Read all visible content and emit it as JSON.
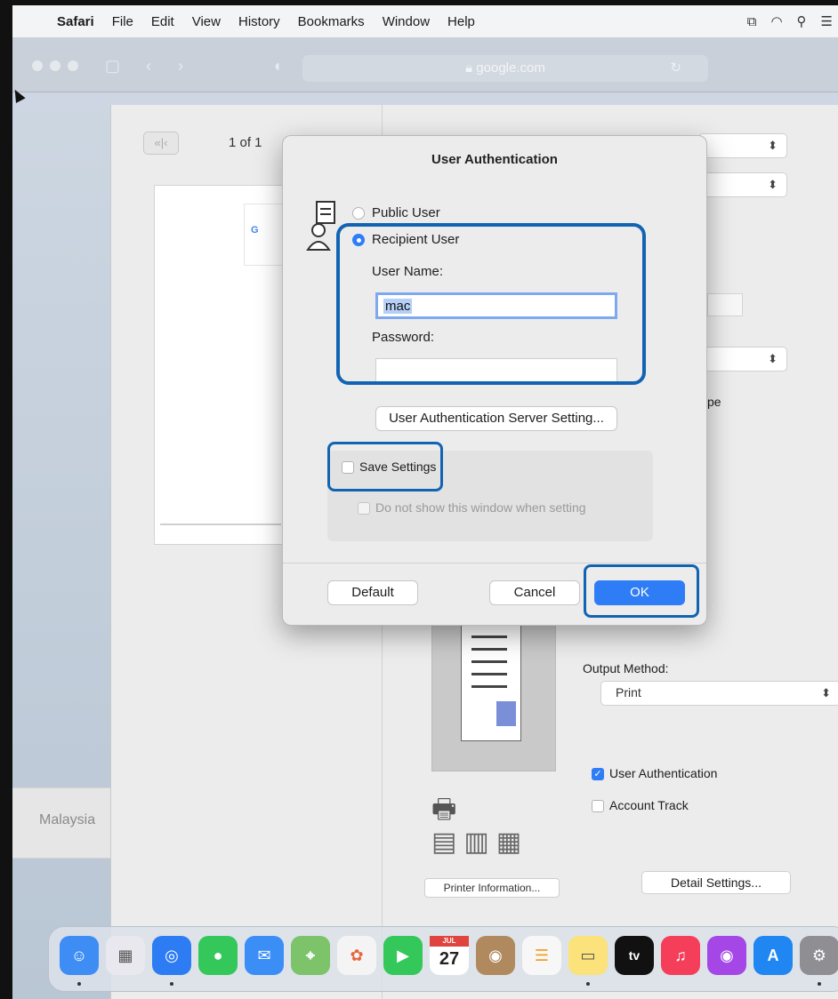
{
  "menubar": {
    "app_name": "Safari",
    "items": [
      "File",
      "Edit",
      "View",
      "History",
      "Bookmarks",
      "Window",
      "Help"
    ]
  },
  "safari": {
    "address": "google.com"
  },
  "print_sheet": {
    "page_count": "1 of 1",
    "region_label": "Malaysia",
    "partial_label": "pe",
    "output_method_label": "Output Method:",
    "output_method_value": "Print",
    "user_auth_label": "User Authentication",
    "user_auth_checked": true,
    "account_track_label": "Account Track",
    "account_track_checked": false,
    "detail_settings_label": "Detail Settings...",
    "printer_info_label": "Printer Information..."
  },
  "dialog": {
    "title": "User Authentication",
    "public_user_label": "Public User",
    "recipient_user_label": "Recipient User",
    "selected_mode": "Recipient User",
    "username_label": "User Name:",
    "username_value": "mac",
    "password_label": "Password:",
    "password_value": "",
    "server_setting_button": "User Authentication Server Setting...",
    "save_settings_label": "Save Settings",
    "save_settings_checked": false,
    "dont_show_label": "Do not show this window when setting",
    "default_button": "Default",
    "cancel_button": "Cancel",
    "ok_button": "OK"
  },
  "dock": {
    "calendar_month": "JUL",
    "calendar_day": "27",
    "apps": [
      "finder",
      "launchpad",
      "safari",
      "messages",
      "mail",
      "maps",
      "photos",
      "facetime",
      "calendar",
      "contacts",
      "reminders",
      "notes",
      "tv",
      "music",
      "podcasts",
      "app-store",
      "system-preferences",
      "printer"
    ]
  },
  "colors": {
    "accent": "#2f7df6",
    "highlight_border": "#1264b2"
  }
}
